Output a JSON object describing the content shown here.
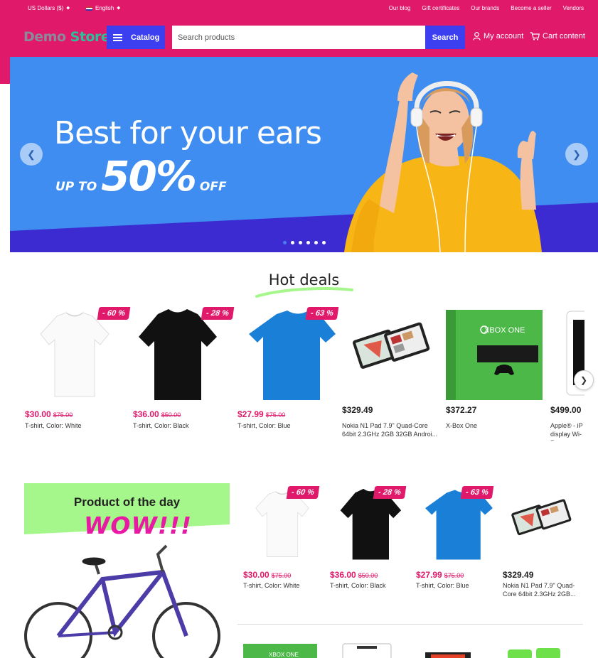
{
  "topbar": {
    "currency": "US Dollars ($)",
    "language": "English",
    "links": [
      "Our blog",
      "Gift certificates",
      "Our brands",
      "Become a seller",
      "Vendors"
    ]
  },
  "header": {
    "logo_part1": "Demo",
    "logo_part2": "Store",
    "catalog_label": "Catalog",
    "search_placeholder": "Search products",
    "search_button": "Search",
    "account_label": "My account",
    "cart_label": "Cart content"
  },
  "banner": {
    "headline": "Best for your ears",
    "sub_prefix": "UP TO",
    "sub_big": "50%",
    "sub_suffix": "OFF",
    "slides": 6,
    "active_slide": 1,
    "colors": {
      "bg": "#3f8df0",
      "stripe": "#3b2bd0",
      "shirt": "#f7b516"
    }
  },
  "hot_deals": {
    "title": "Hot deals",
    "products": [
      {
        "badge": "- 60 %",
        "price": "$30.00",
        "old_price": "$75.00",
        "name": "T-shirt, Color: White"
      },
      {
        "badge": "- 28 %",
        "price": "$36.00",
        "old_price": "$50.00",
        "name": "T-shirt, Color: Black"
      },
      {
        "badge": "- 63 %",
        "price": "$27.99",
        "old_price": "$75.00",
        "name": "T-shirt, Color: Blue"
      },
      {
        "price": "$329.49",
        "name": "Nokia N1 Pad 7.9\" Quad-Core 64bit 2.3GHz 2GB 32GB Androi..."
      },
      {
        "price": "$372.27",
        "name": "X-Box One"
      },
      {
        "price": "$499.00",
        "name": "Apple® - iP display Wi-F"
      }
    ]
  },
  "product_of_day": {
    "title": "Product of the day",
    "wow": "WOW!!!",
    "bg_color": "#a6f78b"
  },
  "grid": {
    "products": [
      {
        "badge": "- 60 %",
        "price": "$30.00",
        "old_price": "$75.00",
        "name": "T-shirt, Color: White"
      },
      {
        "badge": "- 28 %",
        "price": "$36.00",
        "old_price": "$50.00",
        "name": "T-shirt, Color: Black"
      },
      {
        "badge": "- 63 %",
        "price": "$27.99",
        "old_price": "$75.00",
        "name": "T-shirt, Color: Blue"
      },
      {
        "price": "$329.49",
        "name": "Nokia N1 Pad 7.9\" Quad-Core 64bit 2.3GHz 2GB..."
      }
    ],
    "xbox_box_label": "XBOX ONE"
  },
  "colors": {
    "brand": "#e0196b",
    "accent": "#3c3ff0",
    "green": "#4cb848"
  }
}
